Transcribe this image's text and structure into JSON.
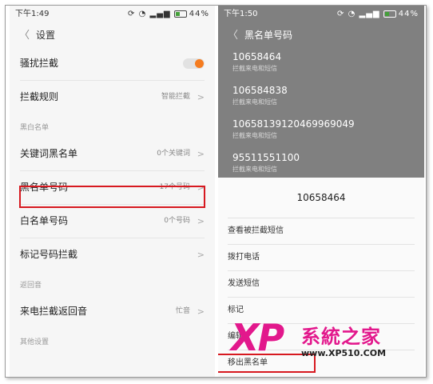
{
  "left": {
    "status": {
      "time": "下午1:49",
      "battery": "44%"
    },
    "title": "设置",
    "toggle_row": {
      "label": "骚扰拦截",
      "state": "on"
    },
    "rule_row": {
      "label": "拦截规则",
      "value": "智能拦截"
    },
    "blacklist_section": "黑白名单",
    "keyword_row": {
      "label": "关键词黑名单",
      "value": "0个关键词"
    },
    "number_row": {
      "label": "黑名单号码",
      "value": "17个号码"
    },
    "white_row": {
      "label": "白名单号码",
      "value": "0个号码"
    },
    "mark_row": {
      "label": "标记号码拦截",
      "value": ""
    },
    "ringback_section": "返回音",
    "ringback_row": {
      "label": "来电拦截返回音",
      "value": "忙音"
    },
    "other_section": "其他设置"
  },
  "right": {
    "status": {
      "time": "下午1:50",
      "battery": "44%"
    },
    "title": "黑名单号码",
    "numbers": [
      {
        "number": "10658464",
        "desc": "拦截来电和短信"
      },
      {
        "number": "10658483​8",
        "desc": "拦截来电和短信"
      },
      {
        "number": "1065813912046996​9049",
        "desc": "拦截来电和短信"
      },
      {
        "number": "95511551100",
        "desc": "拦截来电和短信"
      }
    ],
    "sheet": {
      "title": "10658464",
      "options": [
        "查看被拦截短信",
        "拨打电话",
        "发送短信",
        "标记",
        "编辑",
        "移出黑名单"
      ]
    }
  },
  "watermark": {
    "logo": "XP",
    "text": "系統之家",
    "url": "www.XP510.COM"
  },
  "colors": {
    "toggle_on": "#f57c1f",
    "highlight": "#d71920",
    "watermark": "#e2188c"
  }
}
